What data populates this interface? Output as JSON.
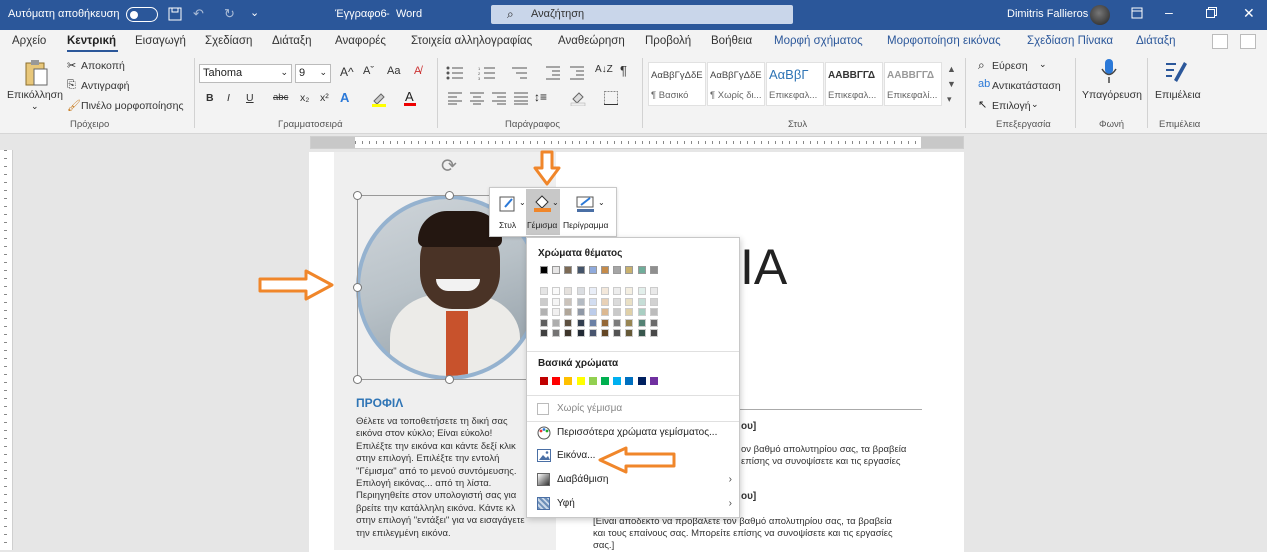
{
  "titlebar": {
    "autosave_label": "Αυτόματη αποθήκευση",
    "doc_title": "Έγγραφο6",
    "app_sep": "-",
    "app_name": "Word",
    "search_placeholder": "Αναζήτηση",
    "user": "Dimitris Fallieros"
  },
  "tabs": [
    "Αρχείο",
    "Κεντρική",
    "Εισαγωγή",
    "Σχεδίαση",
    "Διάταξη",
    "Αναφορές",
    "Στοιχεία αλληλογραφίας",
    "Αναθεώρηση",
    "Προβολή",
    "Βοήθεια",
    "Μορφή σχήματος",
    "Μορφοποίηση εικόνας",
    "Σχεδίαση Πίνακα",
    "Διάταξη"
  ],
  "ribbon": {
    "clipboard": {
      "paste": "Επικόλληση",
      "cut": "Αποκοπή",
      "copy": "Αντιγραφή",
      "painter": "Πινέλο μορφοποίησης",
      "group": "Πρόχειρο"
    },
    "font": {
      "name": "Tahoma",
      "size": "9",
      "group": "Γραμματοσειρά",
      "bold": "B",
      "italic": "I",
      "underline": "U",
      "strike": "abc",
      "sub": "x₂",
      "sup": "x²"
    },
    "paragraph": {
      "group": "Παράγραφος"
    },
    "styles": {
      "group": "Στυλ",
      "items": [
        {
          "sample": "AαBβΓγΔδΕ",
          "name": "¶ Βασικό"
        },
        {
          "sample": "AαBβΓγΔδΕ",
          "name": "¶ Χωρίς δι..."
        },
        {
          "sample": "AαBβΓ",
          "name": "Επικεφαλ..."
        },
        {
          "sample": "AABBΓΓΔ",
          "name": "Επικεφαλ..."
        },
        {
          "sample": "AABBΓΓΔ",
          "name": "Επικεφαλί..."
        }
      ]
    },
    "editing": {
      "find": "Εύρεση",
      "replace": "Αντικατάσταση",
      "select": "Επιλογή",
      "group": "Επεξεργασία"
    },
    "voice": {
      "dictate": "Υπαγόρευση",
      "group": "Φωνή"
    },
    "editor": {
      "editor": "Επιμέλεια",
      "group": "Επιμέλεια"
    }
  },
  "minitoolbar": {
    "style": "Στυλ",
    "fill": "Γέμισμα",
    "outline": "Περίγραμμα"
  },
  "dropdown": {
    "theme_title": "Χρώματα θέματος",
    "theme_top": [
      "#000000",
      "#e7e6e6",
      "#7c6a55",
      "#44546a",
      "#8faadc",
      "#c58b4a",
      "#a5a5a5",
      "#c9b16e",
      "#70ad9a",
      "#8f8f8f"
    ],
    "standard_title": "Βασικά χρώματα",
    "standard": [
      "#c00000",
      "#ff0000",
      "#ffc000",
      "#ffff00",
      "#92d050",
      "#00b050",
      "#00b0f0",
      "#0070c0",
      "#002060",
      "#7030a0"
    ],
    "no_fill": "Χωρίς γέμισμα",
    "more": "Περισσότερα χρώματα γεμίσματος...",
    "picture": "Εικόνα...",
    "gradient": "Διαβάθμιση",
    "texture": "Υφή"
  },
  "document": {
    "heading": "ΠΡΟΦΙΛ",
    "body_lines": [
      "Θέλετε να τοποθετήσετε τη δική σας",
      "εικόνα στον κύκλο;  Είναι εύκολο!",
      "Επιλέξτε την εικόνα και κάντε δεξί κλικ",
      "στην επιλογή.  Επιλέξτε την εντολή",
      "\"Γέμισμα\" από το μενού συντόμευσης.",
      "Επιλογή εικόνας... από τη λίστα.",
      "Περιηγηθείτε στον υπολογιστή σας για",
      "βρείτε την κατάλληλη εικόνα.  Κάντε κλ",
      "στην επιλογή \"εντάξει\" για να εισαγάγετε",
      "την επιλεγμένη εικόνα."
    ],
    "big_text": "ΙΑ",
    "right_h1": "ου]",
    "right_p1a": "ον βαθμό απολυτηρίου σας, τα βραβεία",
    "right_p1b": "επίσης να συνοψίσετε και τις εργασίες",
    "right_h2": "ου]",
    "right_p2a": "[Είναι αποδεκτό να προβάλετε τον βαθμό απολυτηρίου σας, τα βραβεία",
    "right_p2b": "και τους επαίνους σας. Μπορείτε επίσης να συνοψίσετε και τις εργασίες",
    "right_p2c": "σας.]"
  },
  "colors": {
    "word_blue": "#2b579a",
    "accent_orange": "#f0862a",
    "heading_blue": "#2e74b5"
  }
}
